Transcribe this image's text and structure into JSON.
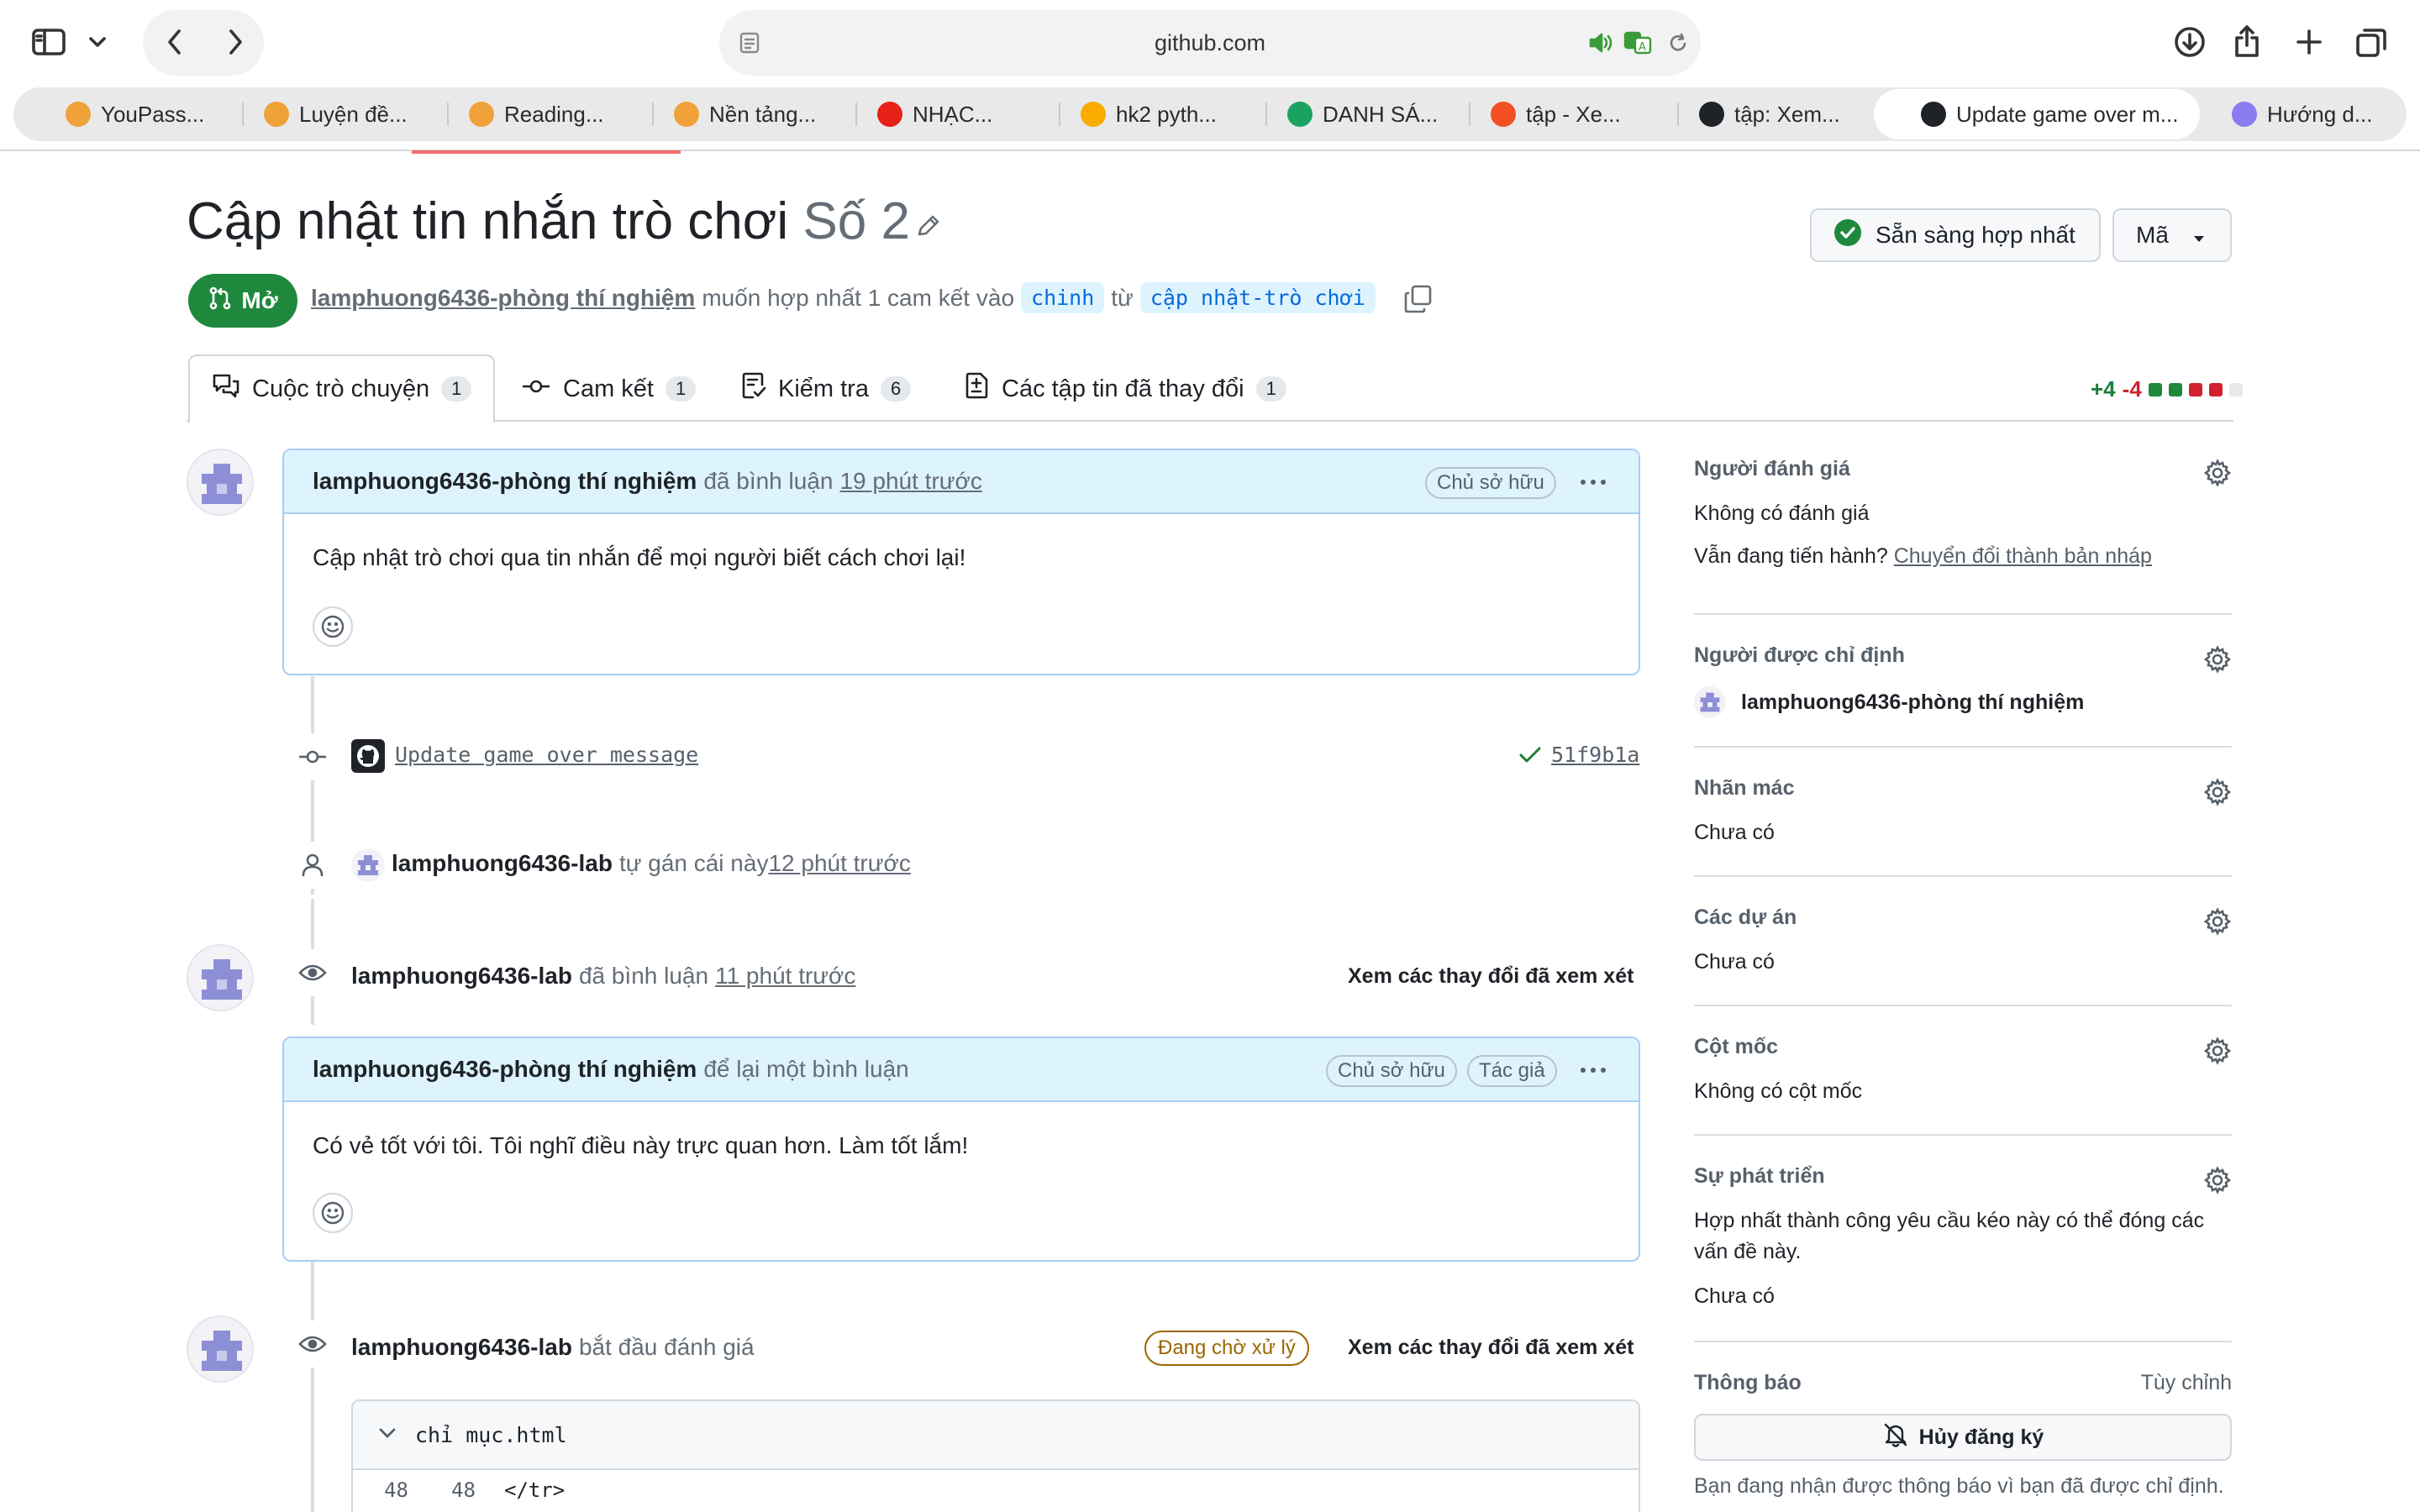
{
  "browser": {
    "url": "github.com",
    "tabs": [
      {
        "label": "YouPass...",
        "icon_color": "#f0a13a"
      },
      {
        "label": "Luyện đề...",
        "icon_color": "#f0a13a"
      },
      {
        "label": "Reading...",
        "icon_color": "#f0a13a"
      },
      {
        "label": "Nền tảng...",
        "icon_color": "#f0a13a"
      },
      {
        "label": "NHẠC...",
        "icon_color": "#e62117"
      },
      {
        "label": "hk2 pyth...",
        "icon_color": "#f9ab00"
      },
      {
        "label": "DANH SÁ...",
        "icon_color": "#1aa260"
      },
      {
        "label": "tập - Xe...",
        "icon_color": "#f25022"
      },
      {
        "label": "tập: Xem...",
        "icon_color": "#1f2328"
      },
      {
        "label": "Update game over m...",
        "icon_color": "#1f2328"
      },
      {
        "label": "Hướng d...",
        "icon_color": "#8a7cf0"
      }
    ]
  },
  "pr": {
    "title": "Cập nhật tin nhắn trò chơi",
    "number": "Số 2",
    "state": "Mở",
    "author": "lamphuong6436-phòng thí nghiệm",
    "merge_text": "muốn hợp nhất 1 cam kết vào",
    "base_branch": "chinh",
    "from_word": "từ",
    "head_branch": "cập nhật-trò chơi",
    "ready_button": "Sẵn sàng hợp nhất",
    "code_button": "Mã"
  },
  "tabs": [
    {
      "label": "Cuộc trò chuyện",
      "count": "1"
    },
    {
      "label": "Cam kết",
      "count": "1"
    },
    {
      "label": "Kiểm tra",
      "count": "6"
    },
    {
      "label": "Các tập tin đã thay đổi",
      "count": "1"
    }
  ],
  "diffstat": {
    "additions": "+4",
    "deletions": "-4"
  },
  "timeline": {
    "comment1": {
      "author": "lamphuong6436-phòng thí nghiệm",
      "action": "đã bình luận",
      "time": "19 phút trước",
      "role": "Chủ sở hữu",
      "body": "Cập nhật trò chơi qua tin nhắn để mọi người biết cách chơi lại!"
    },
    "commit": {
      "message": "Update game over message",
      "sha": "51f9b1a"
    },
    "assign": {
      "user": "lamphuong6436-lab",
      "action": "tự gán cái này",
      "time": "12 phút trước"
    },
    "review1": {
      "user": "lamphuong6436-lab",
      "action": "đã bình luận",
      "time": "11 phút trước",
      "link": "Xem các thay đổi đã xem xét"
    },
    "comment2": {
      "author": "lamphuong6436-phòng thí nghiệm",
      "action": "để lại một bình luận",
      "role1": "Chủ sở hữu",
      "role2": "Tác giả",
      "body": "Có vẻ tốt với tôi. Tôi nghĩ điều này trực quan hơn. Làm tốt lắm!"
    },
    "review2": {
      "user": "lamphuong6436-lab",
      "action": "bắt đầu đánh giá",
      "pending": "Đang chờ xử lý",
      "link": "Xem các thay đổi đã xem xét"
    },
    "file": {
      "name": "chỉ mục.html",
      "line_old": "48",
      "line_new": "48",
      "code": "</tr>"
    }
  },
  "sidebar": {
    "reviewers": {
      "title": "Người đánh giá",
      "value": "Không có đánh giá",
      "prompt": "Vẫn đang tiến hành?",
      "link": "Chuyển đổi thành bản nháp"
    },
    "assignees": {
      "title": "Người được chỉ định",
      "value": "lamphuong6436-phòng thí nghiệm"
    },
    "labels": {
      "title": "Nhãn mác",
      "value": "Chưa có"
    },
    "projects": {
      "title": "Các dự án",
      "value": "Chưa có"
    },
    "milestone": {
      "title": "Cột mốc",
      "value": "Không có cột mốc"
    },
    "development": {
      "title": "Sự phát triển",
      "desc_line1": "Hợp nhất thành công yêu cầu kéo này có thể đóng các",
      "desc_line2": "vấn đề này.",
      "value": "Chưa có"
    },
    "notifications": {
      "title": "Thông báo",
      "customize": "Tùy chỉnh",
      "button": "Hủy đăng ký",
      "note": "Bạn đang nhận được thông báo vì bạn đã được chỉ định."
    }
  }
}
